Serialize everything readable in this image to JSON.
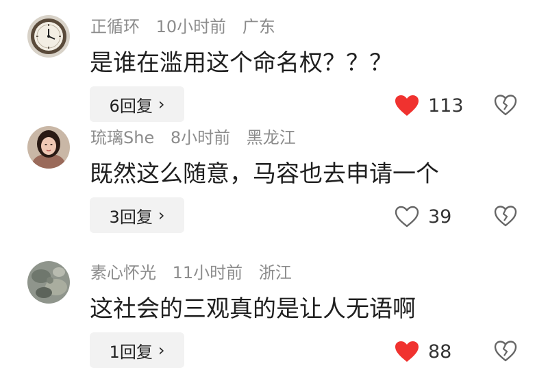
{
  "comments": [
    {
      "username": "正循环",
      "time": "10小时前",
      "location": "广东",
      "text": "是谁在滥用这个命名权？？？",
      "replies_label": "6回复",
      "likes": "113",
      "liked": true,
      "avatar": "wall-clock"
    },
    {
      "username": "琉璃She",
      "time": "8小时前",
      "location": "黑龙江",
      "text": "既然这么随意，马容也去申请一个",
      "replies_label": "3回复",
      "likes": "39",
      "liked": false,
      "avatar": "woman-portrait"
    },
    {
      "username": "素心怀光",
      "time": "11小时前",
      "location": "浙江",
      "text": "这社会的三观真的是让人无语啊",
      "replies_label": "1回复",
      "likes": "88",
      "liked": true,
      "avatar": "stone-texture"
    }
  ],
  "icons": {
    "chevron": "chevron-right-icon",
    "like": "heart-icon",
    "dislike": "broken-heart-icon"
  },
  "colors": {
    "liked_heart": "#f0322f",
    "outline": "#666666",
    "meta_text": "#8c8c8c",
    "reply_bg": "#f2f2f2"
  }
}
